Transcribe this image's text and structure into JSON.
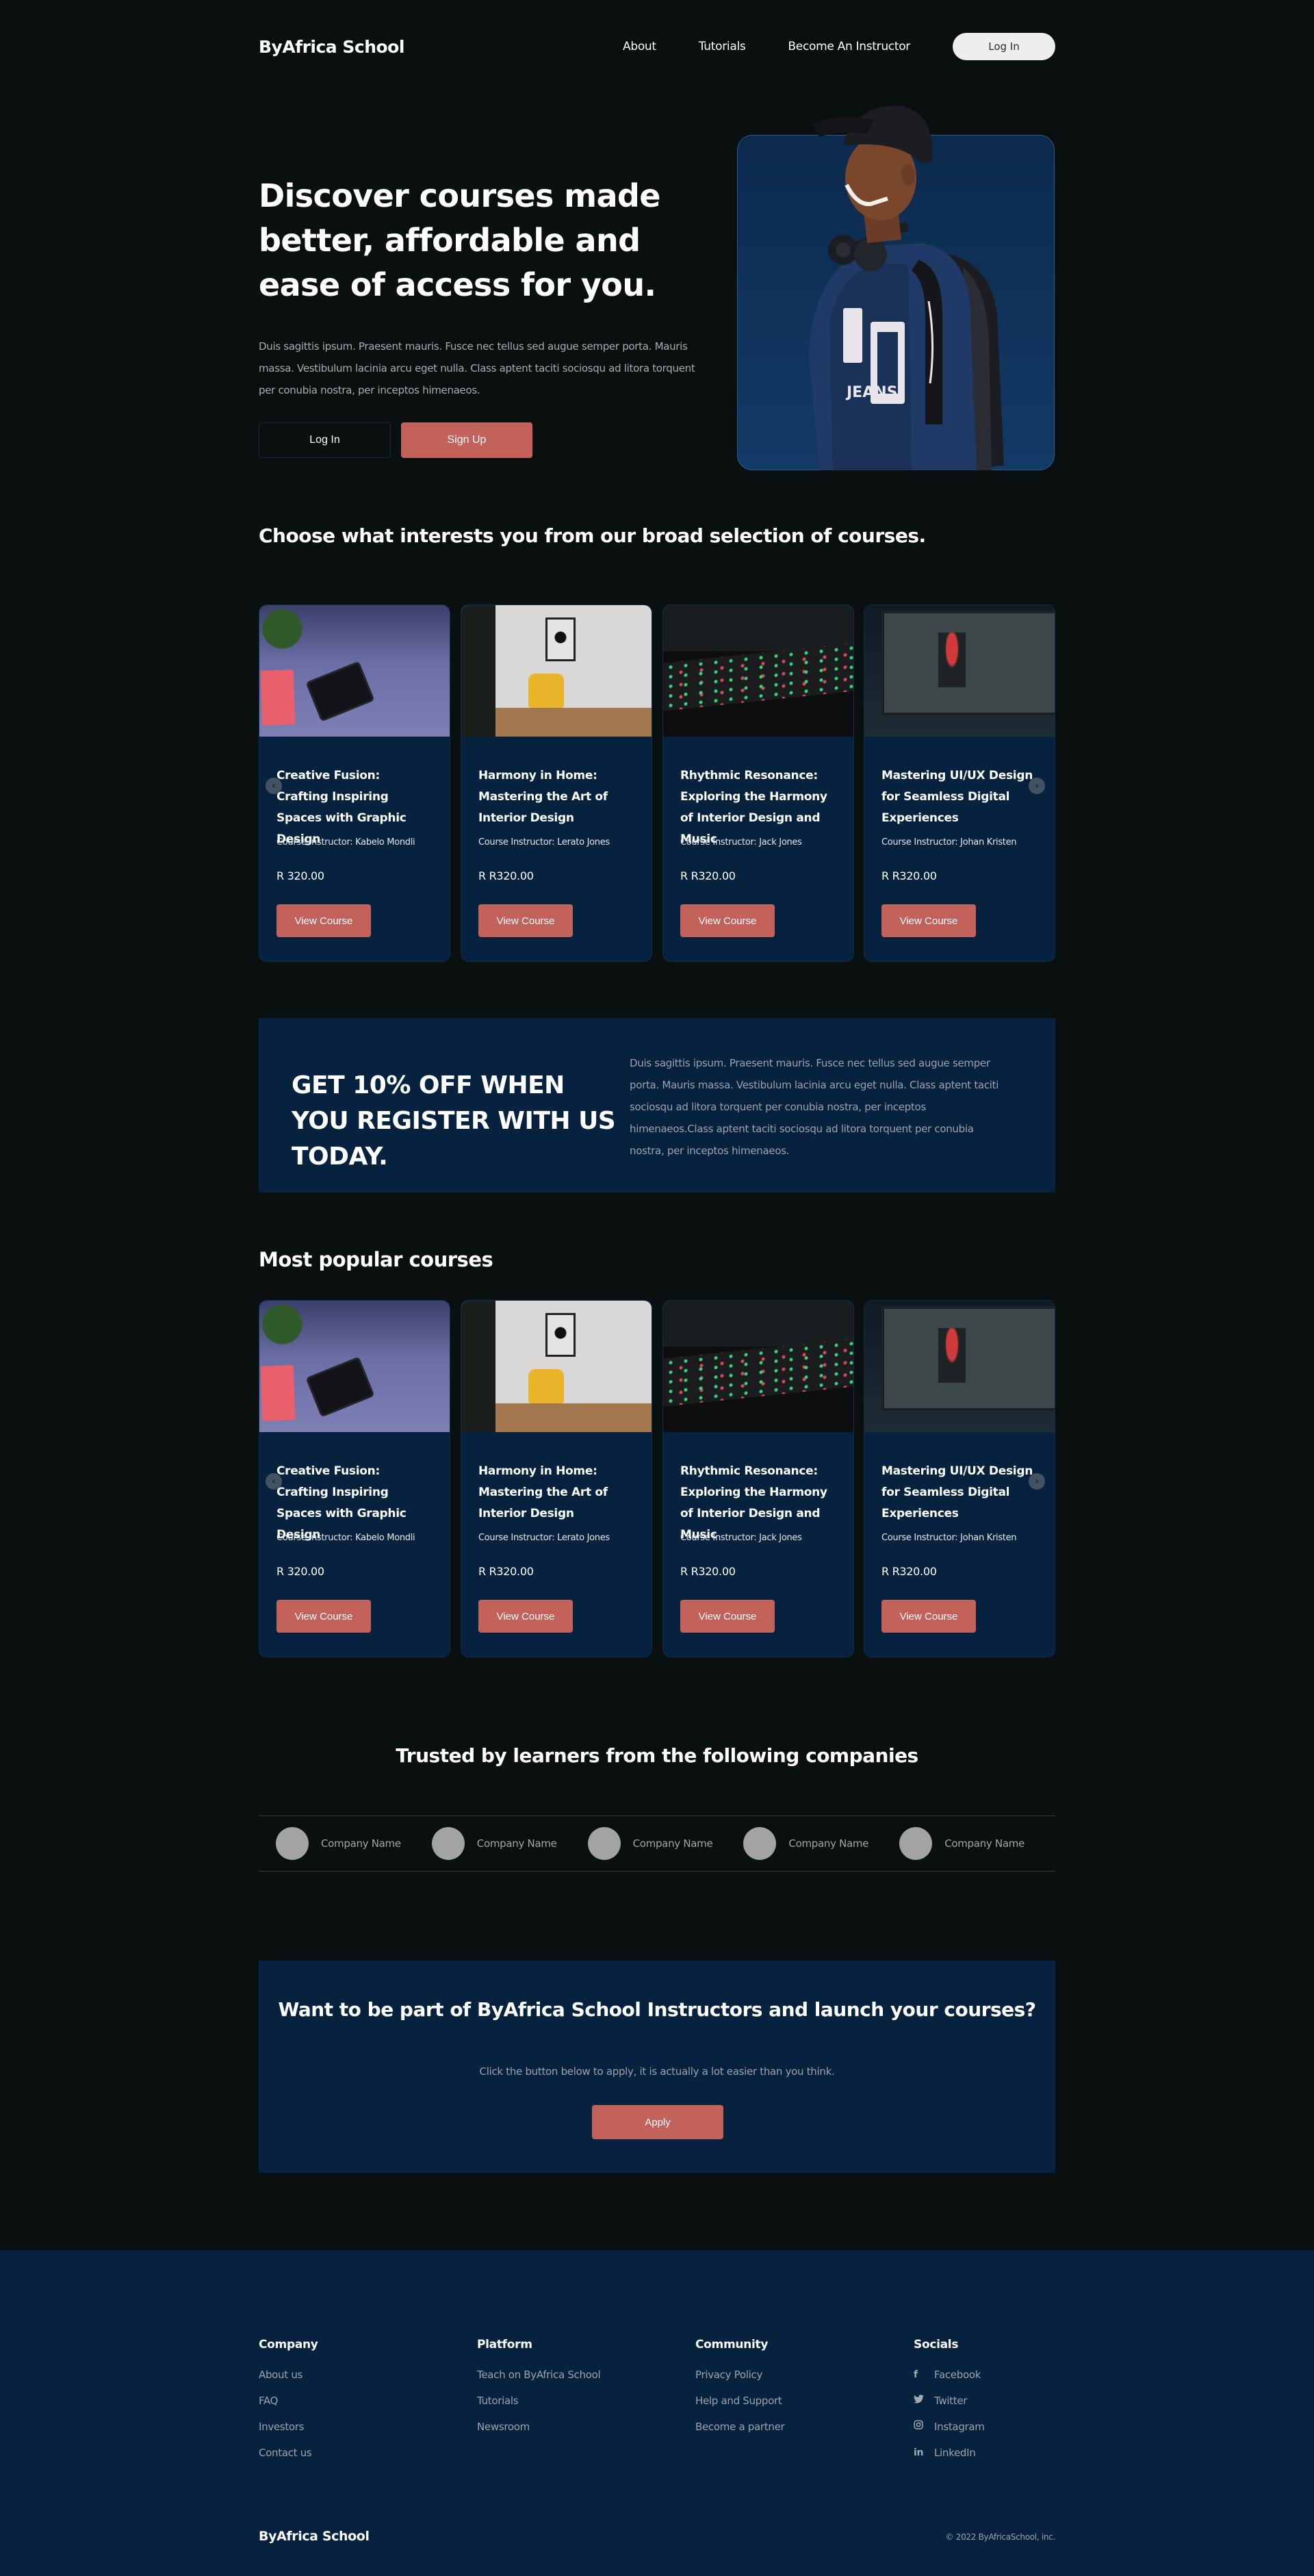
{
  "nav": {
    "brand": "ByAfrica School",
    "links": [
      "About",
      "Tutorials",
      "Become An Instructor"
    ],
    "login": "Log In"
  },
  "hero": {
    "title": "Discover courses made better, affordable and ease of access for you.",
    "description": "Duis sagittis ipsum. Praesent mauris. Fusce nec tellus sed augue semper porta. Mauris massa. Vestibulum lacinia arcu eget nulla. Class aptent taciti sociosqu ad litora torquent per conubia nostra, per inceptos himenaeos.",
    "login_button": "Log In",
    "signup_button": "Sign Up",
    "image_alt": "Smiling student with cap, headphones and backpack"
  },
  "selection": {
    "title": "Choose what interests you from our broad selection of courses.",
    "courses": [
      {
        "title": "Creative Fusion: Crafting Inspiring Spaces with Graphic Design",
        "instructor": "Course Instructor: Kabelo Mondli",
        "price": "R 320.00",
        "button": "View Course",
        "image": "desk-with-adobe-tablet"
      },
      {
        "title": "Harmony in Home: Mastering the Art of Interior Design",
        "instructor": "Course Instructor: Lerato Jones",
        "price": "R R320.00",
        "button": "View Course",
        "image": "yellow-armchair-room"
      },
      {
        "title": "Rhythmic Resonance: Exploring the Harmony of Interior Design and Music",
        "instructor": "Course Instructor: Jack Jones",
        "price": "R R320.00",
        "button": "View Course",
        "image": "mixing-console"
      },
      {
        "title": "Mastering UI/UX Design for Seamless Digital Experiences",
        "instructor": "Course Instructor: Johan Kristen",
        "price": "R R320.00",
        "button": "View Course",
        "image": "laptop-photoshop"
      }
    ]
  },
  "promo": {
    "title": "GET 10% OFF WHEN YOU REGISTER WITH US TODAY.",
    "text": "Duis sagittis ipsum. Praesent mauris. Fusce nec tellus sed augue semper porta. Mauris massa. Vestibulum lacinia arcu eget nulla. Class aptent taciti sociosqu ad litora torquent per conubia nostra, per inceptos himenaeos.Class aptent taciti sociosqu ad litora torquent per conubia nostra, per inceptos himenaeos."
  },
  "popular": {
    "title": "Most popular courses",
    "courses": [
      {
        "title": "Creative Fusion: Crafting Inspiring Spaces with Graphic Design",
        "instructor": "Course Instructor: Kabelo Mondli",
        "price": "R 320.00",
        "button": "View Course",
        "image": "desk-with-adobe-tablet"
      },
      {
        "title": "Harmony in Home: Mastering the Art of Interior Design",
        "instructor": "Course Instructor: Lerato Jones",
        "price": "R R320.00",
        "button": "View Course",
        "image": "yellow-armchair-room"
      },
      {
        "title": "Rhythmic Resonance: Exploring the Harmony of Interior Design and Music",
        "instructor": "Course Instructor: Jack Jones",
        "price": "R R320.00",
        "button": "View Course",
        "image": "mixing-console"
      },
      {
        "title": "Mastering UI/UX Design for Seamless Digital Experiences",
        "instructor": "Course Instructor: Johan Kristen",
        "price": "R R320.00",
        "button": "View Course",
        "image": "laptop-photoshop"
      }
    ]
  },
  "carousel_icons": {
    "prev": "chevron-left-icon",
    "next": "chevron-right-icon",
    "prev_glyph": "‹",
    "next_glyph": "›"
  },
  "trusted": {
    "title": "Trusted by learners from the following companies",
    "companies": [
      "Company Name",
      "Company Name",
      "Company Name",
      "Company Name",
      "Company Name"
    ]
  },
  "cta": {
    "title": "Want to be part of ByAfrica School Instructors and launch your courses?",
    "text": "Click the button below to apply, it is actually a lot easier than you think.",
    "button": "Apply"
  },
  "footer": {
    "columns": [
      {
        "heading": "Company",
        "links": [
          "About us",
          "FAQ",
          "Investors",
          "Contact us"
        ]
      },
      {
        "heading": "Platform",
        "links": [
          "Teach on ByAfrica School",
          "Tutorials",
          "Newsroom"
        ]
      },
      {
        "heading": "Community",
        "links": [
          "Privacy Policy",
          "Help and Support",
          "Become a partner"
        ]
      }
    ],
    "socials": {
      "heading": "Socials",
      "links": [
        {
          "label": "Facebook",
          "icon": "facebook-icon",
          "glyph": "f"
        },
        {
          "label": "Twitter",
          "icon": "twitter-icon",
          "glyph": "🐦"
        },
        {
          "label": "Instagram",
          "icon": "instagram-icon",
          "glyph": "◎"
        },
        {
          "label": "LinkedIn",
          "icon": "linkedin-icon",
          "glyph": "in"
        }
      ]
    },
    "brand": "ByAfrica School",
    "copyright": "© 2022 ByAfricaSchool, inc."
  },
  "colors": {
    "background": "#0a0f10",
    "panel": "#06223f",
    "accent": "#c2625a",
    "muted_text": "#9ba3ad"
  }
}
